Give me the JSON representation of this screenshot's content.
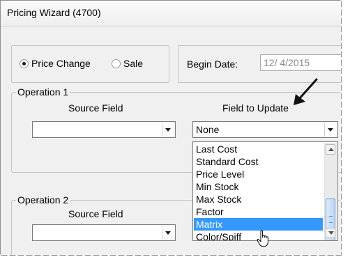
{
  "window": {
    "title": "Pricing Wizard (4700)"
  },
  "mode": {
    "options": [
      {
        "label": "Price Change",
        "selected": true
      },
      {
        "label": "Sale",
        "selected": false
      }
    ]
  },
  "begin_date": {
    "label": "Begin Date:",
    "value": "12/  4/2015"
  },
  "operation1": {
    "legend": "Operation 1",
    "source_label": "Source Field",
    "source_value": "",
    "target_label": "Field to Update",
    "target_value": "None"
  },
  "operation2": {
    "legend": "Operation 2",
    "source_label": "Source Field",
    "source_value": ""
  },
  "dropdown": {
    "items": [
      "Last Cost",
      "Standard Cost",
      "Price Level",
      "Min Stock",
      "Max Stock",
      "Factor",
      "Matrix",
      "Color/Spiff"
    ],
    "highlighted": "Matrix"
  },
  "icons": {
    "annotation": "arrow-pointer-icon",
    "cursor": "hand-cursor-icon"
  },
  "colors": {
    "selection": "#3399ff",
    "window_bg": "#f0f0f0"
  }
}
